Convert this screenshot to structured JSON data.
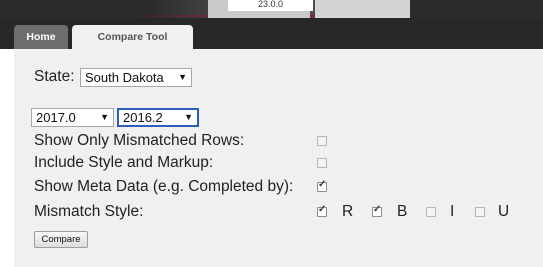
{
  "header": {
    "partial_text": "23.0.0"
  },
  "tabs": [
    {
      "label": "Home",
      "active": false
    },
    {
      "label": "Compare Tool",
      "active": true
    }
  ],
  "form": {
    "state_label": "State:",
    "state_value": "South Dakota",
    "version_left": "2017.0",
    "version_right": "2016.2",
    "options": [
      {
        "label": "Show Only Mismatched Rows:",
        "checked": false
      },
      {
        "label": "Include Style and Markup:",
        "checked": false
      },
      {
        "label": "Show Meta Data (e.g. Completed by):",
        "checked": true
      },
      {
        "label": "Mismatch Style:"
      }
    ],
    "styles": [
      {
        "letter": "R",
        "checked": true
      },
      {
        "letter": "B",
        "checked": true
      },
      {
        "letter": "I",
        "checked": false
      },
      {
        "letter": "U",
        "checked": false
      }
    ],
    "compare_button": "Compare"
  },
  "colors": {
    "nav_bg": "#282828",
    "panel_bg": "#f0f0f0",
    "select_focus": "#2d5fb8"
  }
}
